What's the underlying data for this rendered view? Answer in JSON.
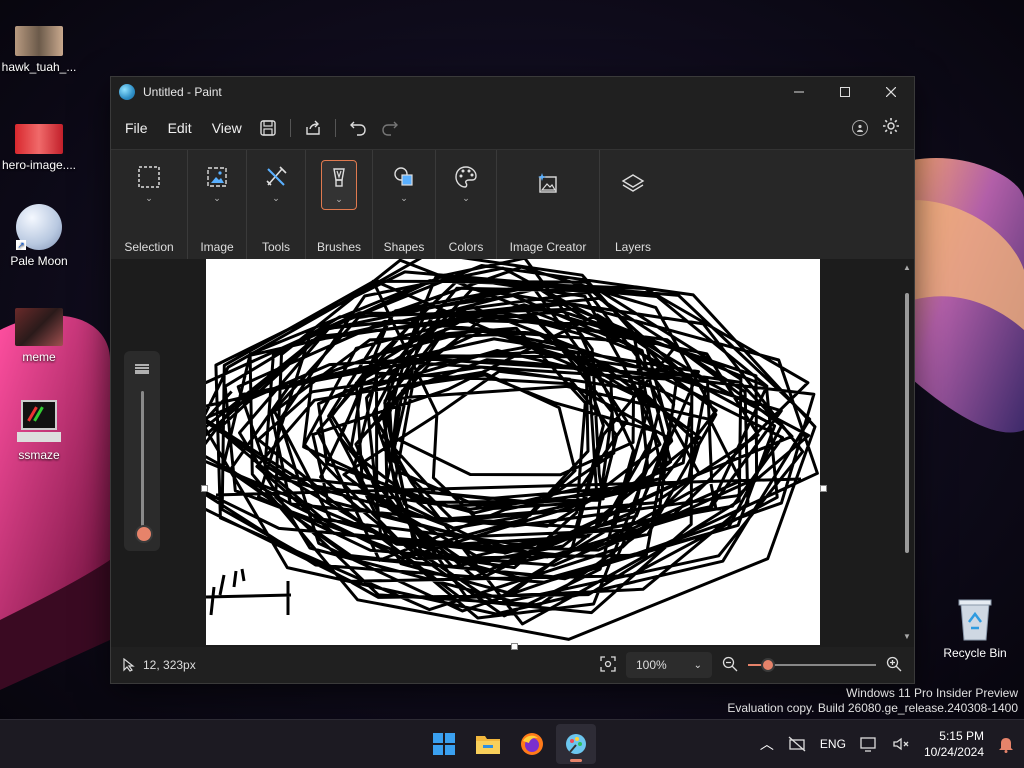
{
  "desktop": {
    "icons": [
      {
        "label": "hawk_tuah_..."
      },
      {
        "label": "hero-image...."
      },
      {
        "label": "Pale Moon"
      },
      {
        "label": "meme"
      },
      {
        "label": "ssmaze"
      }
    ],
    "recycle_bin": "Recycle Bin",
    "watermark": {
      "line1": "Windows 11 Pro Insider Preview",
      "line2": "Evaluation copy. Build 26080.ge_release.240308-1400"
    }
  },
  "window": {
    "title": "Untitled - Paint",
    "menu": {
      "file": "File",
      "edit": "Edit",
      "view": "View"
    },
    "ribbon": {
      "selection": "Selection",
      "image": "Image",
      "tools": "Tools",
      "brushes": "Brushes",
      "shapes": "Shapes",
      "colors": "Colors",
      "image_creator": "Image Creator",
      "layers": "Layers"
    },
    "status": {
      "cursor_position": "12, 323px",
      "zoom": "100%",
      "zoom_slider_fraction": 0.16
    },
    "brush_size_fraction": 0.0
  },
  "taskbar": {
    "language": "ENG",
    "time": "5:15 PM",
    "date": "10/24/2024"
  },
  "colors": {
    "accent": "#e6836a",
    "window_bg": "#202020",
    "ribbon_bg": "#272727"
  }
}
